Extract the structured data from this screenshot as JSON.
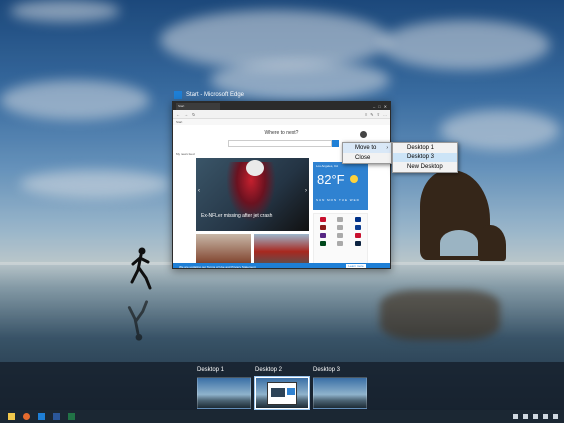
{
  "window": {
    "title": "Start - Microsoft Edge",
    "tab_label": "Start",
    "fav_label": "Start",
    "caption_buttons": [
      "–",
      "□",
      "✕"
    ],
    "icons": {
      "back": "back-arrow-icon",
      "forward": "forward-arrow-icon",
      "refresh": "refresh-icon"
    }
  },
  "page": {
    "heading": "Where to next?",
    "feed_label": "My news feed",
    "hero_caption": "Ex-NFLer missing after jet crash",
    "weather_location": "Los Angeles, CA",
    "weather_temp": "82°F",
    "weather_days": "SUN MON TUE WED",
    "infobar_text": "We are updating our Terms of Use and Privacy Statement",
    "infobar_button": "Learn more"
  },
  "context_menu": {
    "items": [
      {
        "label": "Move to",
        "has_submenu": true,
        "active": true
      },
      {
        "label": "Close",
        "has_submenu": false,
        "active": false
      }
    ],
    "submenu": [
      {
        "label": "Desktop 1",
        "active": false
      },
      {
        "label": "Desktop 3",
        "active": true
      },
      {
        "label": "New Desktop",
        "active": false
      }
    ]
  },
  "desktops": [
    {
      "label": "Desktop 1",
      "current": false
    },
    {
      "label": "Desktop 2",
      "current": true
    },
    {
      "label": "Desktop 3",
      "current": false
    }
  ],
  "taskbar": {
    "icons": [
      "file-explorer-icon",
      "edge-icon",
      "store-icon",
      "word-icon",
      "excel-icon"
    ]
  },
  "colors": {
    "accent": "#1e7fd6",
    "menu_highlight": "#cce4f7",
    "taskbar": "#1b2733"
  }
}
